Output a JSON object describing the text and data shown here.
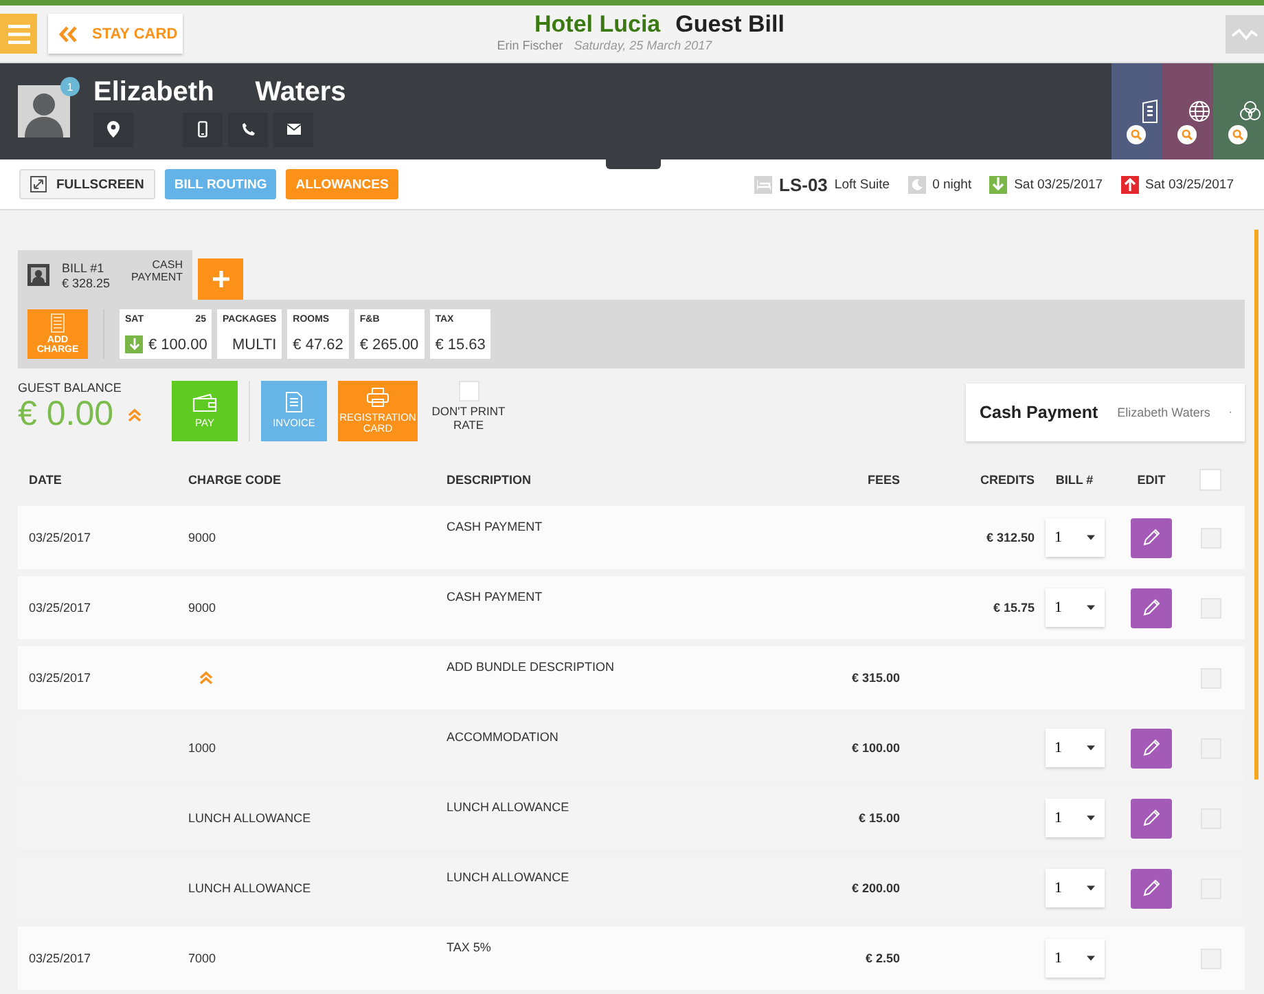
{
  "top_bar": {
    "stay_card_button": "STAY CARD",
    "hotel_name": "Hotel Lucia",
    "page_title": "Guest Bill",
    "user_name": "Erin Fischer",
    "date": "Saturday, 25 March 2017"
  },
  "guest": {
    "first_name": "Elizabeth",
    "last_name": "Waters",
    "badge": "1"
  },
  "toolbar": {
    "buttons": [
      {
        "label": "FULLSCREEN",
        "kind": "plain"
      },
      {
        "label": "BILL ROUTING",
        "kind": "blue"
      },
      {
        "label": "ALLOWANCES",
        "kind": "orange"
      }
    ]
  },
  "stay": {
    "room": "LS-03",
    "room_type": "Loft Suite",
    "nights": "0 night",
    "arrival": "Sat 03/25/2017",
    "departure": "Sat 03/25/2017"
  },
  "bill_tabs": [
    {
      "title": "BILL #1",
      "amount": "€ 328.25",
      "payment": "CASH PAYMENT",
      "selected": true
    }
  ],
  "add_charge_button": "ADD CHARGE",
  "summary": [
    {
      "label": "SAT",
      "day": "25",
      "value": "€ 100.00",
      "arrival": true
    },
    {
      "label": "PACKAGES",
      "value": "MULTI",
      "arrival": false
    },
    {
      "label": "ROOMS",
      "value": "€ 47.62",
      "arrival": false
    },
    {
      "label": "F&B",
      "value": "€ 265.00",
      "arrival": false
    },
    {
      "label": "TAX",
      "value": "€ 15.63",
      "arrival": false
    }
  ],
  "balance": {
    "label": "GUEST BALANCE",
    "value": "€ 0.00"
  },
  "actions": [
    {
      "label": "PAY",
      "kind": "pay"
    },
    {
      "label": "INVOICE",
      "kind": "invoice"
    },
    {
      "label": "REGISTRATION CARD",
      "kind": "registration"
    }
  ],
  "dont_print_rate": {
    "label": "DON'T PRINT RATE",
    "checked": false
  },
  "payment_method": {
    "method": "Cash Payment",
    "payer": "Elizabeth Waters"
  },
  "table": {
    "columns": [
      "DATE",
      "CHARGE CODE",
      "DESCRIPTION",
      "FEES",
      "CREDITS",
      "BILL #",
      "EDIT"
    ],
    "select_all_checked": false,
    "rows": [
      {
        "date": "03/25/2017",
        "code": "9000",
        "description": "CASH PAYMENT",
        "credits": "€ 312.50",
        "bill": "1",
        "editable": true,
        "checked": false
      },
      {
        "date": "03/25/2017",
        "code": "9000",
        "description": "CASH PAYMENT",
        "credits": "€ 15.75",
        "bill": "1",
        "editable": true,
        "checked": false
      },
      {
        "date": "03/25/2017",
        "description": "ADD BUNDLE DESCRIPTION",
        "fees": "€ 315.00",
        "editable": false,
        "checked": false,
        "expanded": true,
        "children": [
          {
            "code": "1000",
            "description": "ACCOMMODATION",
            "fees": "€ 100.00",
            "bill": "1",
            "editable": true,
            "checked": false
          },
          {
            "code": "LUNCH ALLOWANCE",
            "description": "LUNCH ALLOWANCE",
            "fees": "€ 15.00",
            "bill": "1",
            "editable": true,
            "checked": false
          },
          {
            "code": "LUNCH ALLOWANCE",
            "description": "LUNCH ALLOWANCE",
            "fees": "€ 200.00",
            "bill": "1",
            "editable": true,
            "checked": false
          }
        ]
      },
      {
        "date": "03/25/2017",
        "code": "7000",
        "description": "TAX 5%",
        "fees": "€ 2.50",
        "bill": "1",
        "editable": false,
        "checked": false
      }
    ]
  }
}
